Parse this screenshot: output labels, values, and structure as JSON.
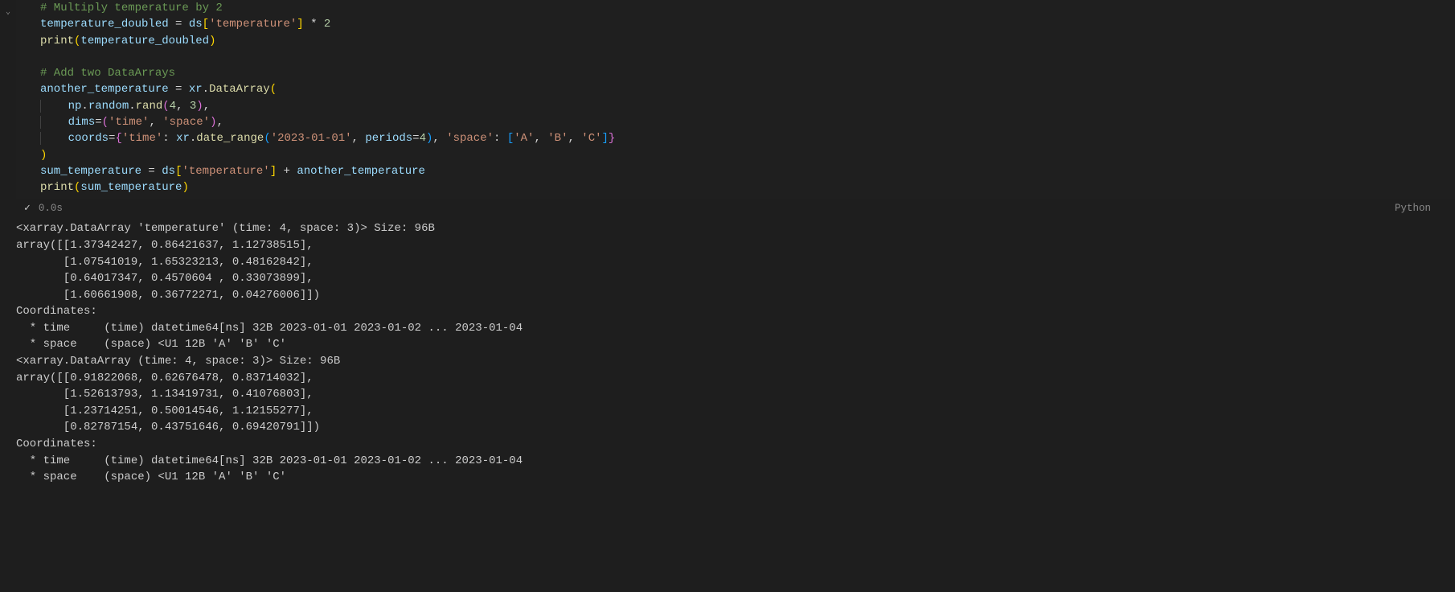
{
  "code": {
    "c1": "# Multiply temperature by 2",
    "l2_var": "temperature_doubled",
    "l2_ds": "ds",
    "l2_key": "'temperature'",
    "l2_two": "2",
    "l3_print": "print",
    "l3_arg": "temperature_doubled",
    "c2": "# Add two DataArrays",
    "l5_var": "another_temperature",
    "l5_xr": "xr",
    "l5_da": "DataArray",
    "l6_np": "np",
    "l6_random": "random",
    "l6_rand": "rand",
    "l6_a": "4",
    "l6_b": "3",
    "l7_dims": "dims",
    "l7_time": "'time'",
    "l7_space": "'space'",
    "l8_coords": "coords",
    "l8_timek": "'time'",
    "l8_xr": "xr",
    "l8_dr": "date_range",
    "l8_date": "'2023-01-01'",
    "l8_periods": "periods",
    "l8_pval": "4",
    "l8_spacek": "'space'",
    "l8_A": "'A'",
    "l8_B": "'B'",
    "l8_C": "'C'",
    "l10_var": "sum_temperature",
    "l10_ds": "ds",
    "l10_key": "'temperature'",
    "l10_plus": "another_temperature",
    "l11_print": "print",
    "l11_arg": "sum_temperature"
  },
  "status": {
    "time": "0.0s",
    "lang": "Python"
  },
  "output_text": "<xarray.DataArray 'temperature' (time: 4, space: 3)> Size: 96B\narray([[1.37342427, 0.86421637, 1.12738515],\n       [1.07541019, 1.65323213, 0.48162842],\n       [0.64017347, 0.4570604 , 0.33073899],\n       [1.60661908, 0.36772271, 0.04276006]])\nCoordinates:\n  * time     (time) datetime64[ns] 32B 2023-01-01 2023-01-02 ... 2023-01-04\n  * space    (space) <U1 12B 'A' 'B' 'C'\n<xarray.DataArray (time: 4, space: 3)> Size: 96B\narray([[0.91822068, 0.62676478, 0.83714032],\n       [1.52613793, 1.13419731, 0.41076803],\n       [1.23714251, 0.50014546, 1.12155277],\n       [0.82787154, 0.43751646, 0.69420791]])\nCoordinates:\n  * time     (time) datetime64[ns] 32B 2023-01-01 2023-01-02 ... 2023-01-04\n  * space    (space) <U1 12B 'A' 'B' 'C'"
}
